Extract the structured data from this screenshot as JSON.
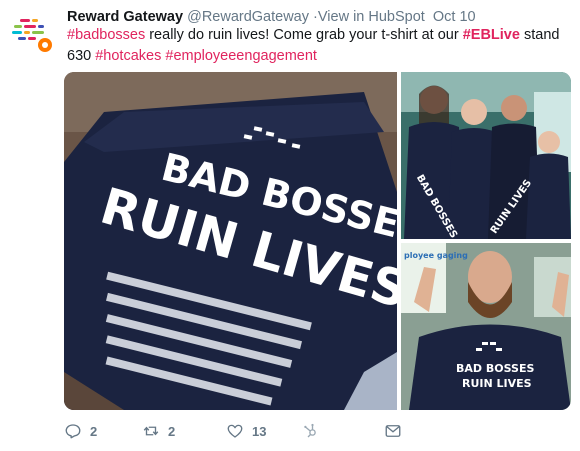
{
  "tweet": {
    "author_name": "Reward Gateway",
    "author_handle": "@RewardGateway",
    "via": "View in HubSpot",
    "date": "Oct 10",
    "text_parts": [
      {
        "type": "hashtag",
        "text": "#badbosses"
      },
      {
        "type": "text",
        "text": " really do ruin lives! Come grab your t-shirt at our "
      },
      {
        "type": "hashtag_bold",
        "text": "#EBLive"
      },
      {
        "type": "text",
        "text": " stand 630 "
      },
      {
        "type": "hashtag",
        "text": "#hotcakes"
      },
      {
        "type": "text",
        "text": " "
      },
      {
        "type": "hashtag",
        "text": "#employeeengagement"
      }
    ]
  },
  "media": {
    "main_shirt_line1": "BAD BOSSES",
    "main_shirt_line2": "RUIN LIVES",
    "group_shirt_line1": "BAD BOSSES",
    "group_shirt_line2": "RUIN LIVES",
    "man_shirt_line1": "BAD BOSSES",
    "man_shirt_line2": "RUIN LIVES",
    "banner_text": "ployee\ngaging"
  },
  "actions": {
    "reply_count": "2",
    "retweet_count": "2",
    "like_count": "13"
  },
  "colors": {
    "hashtag": "#e0245e",
    "muted": "#657786",
    "shirt_navy": "#1b2340"
  }
}
